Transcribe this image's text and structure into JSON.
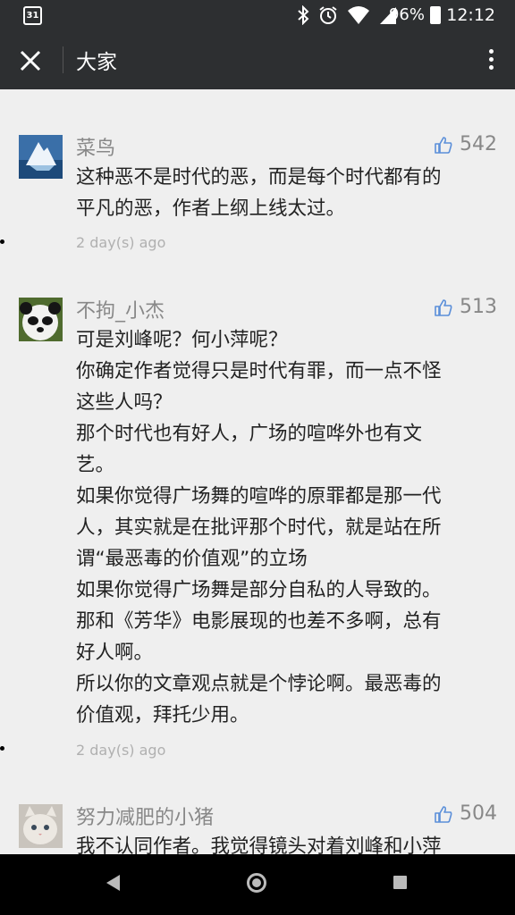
{
  "status_bar": {
    "calendar_day": "31",
    "battery_percent": "96%",
    "time": "12:12"
  },
  "header": {
    "title": "大家"
  },
  "comments": [
    {
      "author": "菜鸟",
      "likes": "542",
      "lines": [
        "这种恶不是时代的恶，而是每个时代都有的",
        "平凡的恶，作者上纲上线太过。"
      ],
      "time": "2 day(s) ago"
    },
    {
      "author": "不拘_小杰",
      "likes": "513",
      "lines": [
        "可是刘峰呢？何小萍呢？",
        "你确定作者觉得只是时代有罪，而一点不怪",
        "这些人吗？",
        "那个时代也有好人，广场的喧哗外也有文",
        "艺。",
        "如果你觉得广场舞的喧哗的原罪都是那一代",
        "人，其实就是在批评那个时代，就是站在所",
        "谓“最恶毒的价值观”的立场",
        "如果你觉得广场舞是部分自私的人导致的。",
        "那和《芳华》电影展现的也差不多啊，总有",
        "好人啊。",
        "所以你的文章观点就是个悖论啊。最恶毒的",
        "价值观，拜托少用。"
      ],
      "time": "2 day(s) ago"
    },
    {
      "author": "努力减肥的小猪",
      "likes": "504",
      "lines": [
        "我不认同作者。我觉得镜头对着刘峰和小萍"
      ],
      "time": ""
    }
  ],
  "icons": {
    "close": "close-icon",
    "more": "more-vertical-icon",
    "like": "thumbs-up-icon",
    "bluetooth": "bluetooth-icon",
    "alarm": "alarm-icon",
    "wifi": "wifi-icon",
    "signal": "signal-icon",
    "battery": "battery-icon"
  },
  "colors": {
    "bar": "#2d2f31",
    "background": "#efefef",
    "like": "#5b8fd9"
  }
}
